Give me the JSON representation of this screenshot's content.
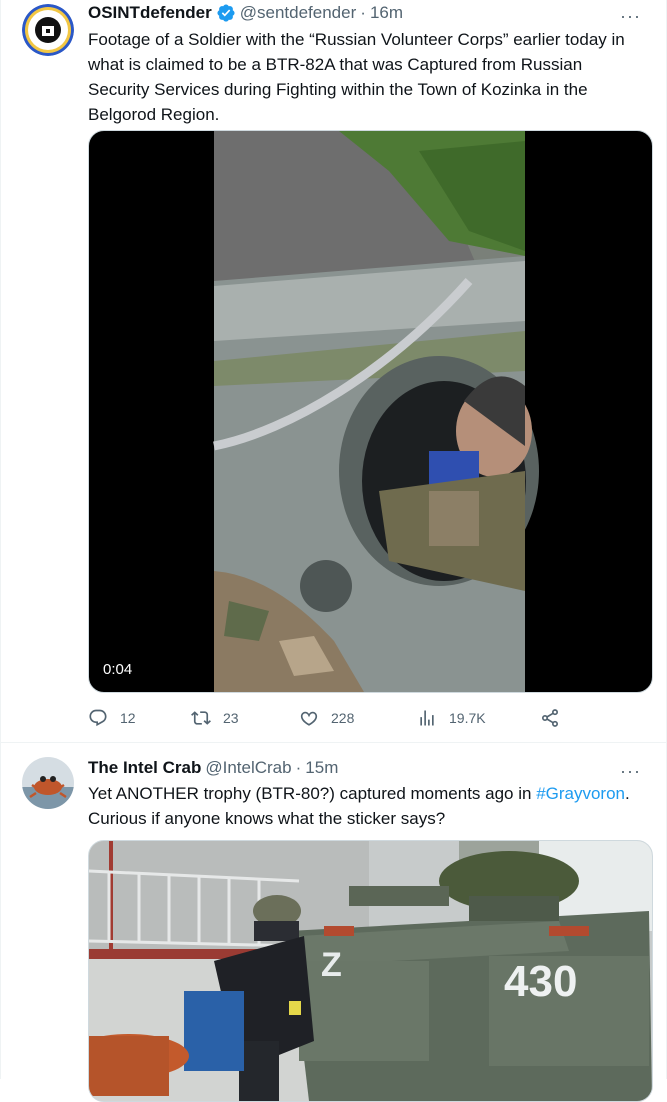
{
  "tweets": [
    {
      "author": "OSINTdefender",
      "handle": "@sentdefender",
      "time": "16m",
      "text": "Footage of a Soldier with the “Russian Volunteer Corps” earlier today in what is claimed to be a BTR-82A that was Captured from Russian Security Services during Fighting within the Town of Kozinka in the Belgorod Region.",
      "video_duration": "0:04",
      "stats": {
        "replies": "12",
        "retweets": "23",
        "likes": "228",
        "views": "19.7K"
      }
    },
    {
      "author": "The Intel Crab",
      "handle": "@IntelCrab",
      "time": "15m",
      "text_before": "Yet ANOTHER trophy (BTR-80?) captured moments ago in ",
      "hashtag": "#Grayvoron",
      "text_after": ". Curious if anyone knows what the sticker says?",
      "vehicle_number": "430",
      "vehicle_marking": "Z"
    }
  ],
  "more_glyph": "···",
  "dot": "·",
  "colors": {
    "link": "#1d9bf0",
    "verified": "#1d9bf0",
    "secondary": "#536471"
  }
}
